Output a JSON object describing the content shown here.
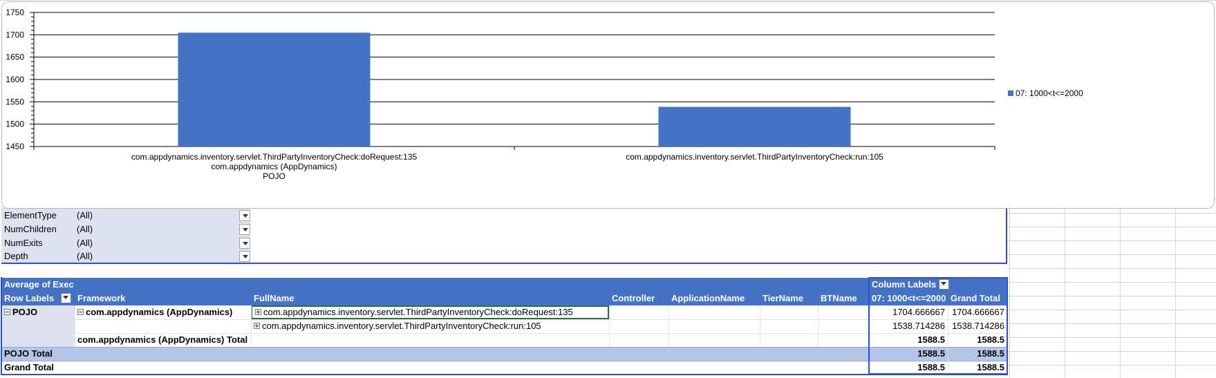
{
  "chart_data": {
    "type": "bar",
    "categories": [
      [
        "com.appdynamics.inventory.servlet.ThirdPartyInventoryCheck:doRequest:135",
        "com.appdynamics (AppDynamics)",
        "POJO"
      ],
      [
        "com.appdynamics.inventory.servlet.ThirdPartyInventoryCheck:run:105"
      ]
    ],
    "series": [
      {
        "name": "07: 1000<t<=2000",
        "values": [
          1704.666667,
          1538.714286
        ],
        "color": "#4472c4"
      }
    ],
    "ylim": [
      1450,
      1750
    ],
    "yticks": [
      "1450",
      "1500",
      "1550",
      "1600",
      "1650",
      "1700",
      "1750"
    ],
    "grid": true,
    "legend": "right"
  },
  "filters": [
    {
      "name": "ElementType",
      "value": "(All)"
    },
    {
      "name": "NumChildren",
      "value": "(All)"
    },
    {
      "name": "NumExits",
      "value": "(All)"
    },
    {
      "name": "Depth",
      "value": "(All)"
    }
  ],
  "pivot": {
    "values_label": "Average of Exec",
    "column_labels": "Column Labels",
    "headers": {
      "row_labels": "Row Labels",
      "framework": "Framework",
      "fullname": "FullName",
      "controller": "Controller",
      "application": "ApplicationName",
      "tier": "TierName",
      "bt": "BTName",
      "bucket": "07: 1000<t<=2000",
      "grand_total": "Grand Total"
    },
    "rows": {
      "pojo": "POJO",
      "framework": "com.appdynamics (AppDynamics)",
      "fullname1": "com.appdynamics.inventory.servlet.ThirdPartyInventoryCheck:doRequest:135",
      "val1": "1704.666667",
      "gt1": "1704.666667",
      "fullname2": "com.appdynamics.inventory.servlet.ThirdPartyInventoryCheck:run:105",
      "val2": "1538.714286",
      "gt2": "1538.714286",
      "framework_total": "com.appdynamics (AppDynamics) Total",
      "framework_total_val": "1588.5",
      "framework_total_gt": "1588.5",
      "pojo_total": "POJO Total",
      "pojo_total_val": "1588.5",
      "pojo_total_gt": "1588.5",
      "grand_total": "Grand Total",
      "grand_total_val": "1588.5",
      "grand_total_gt": "1588.5"
    }
  }
}
